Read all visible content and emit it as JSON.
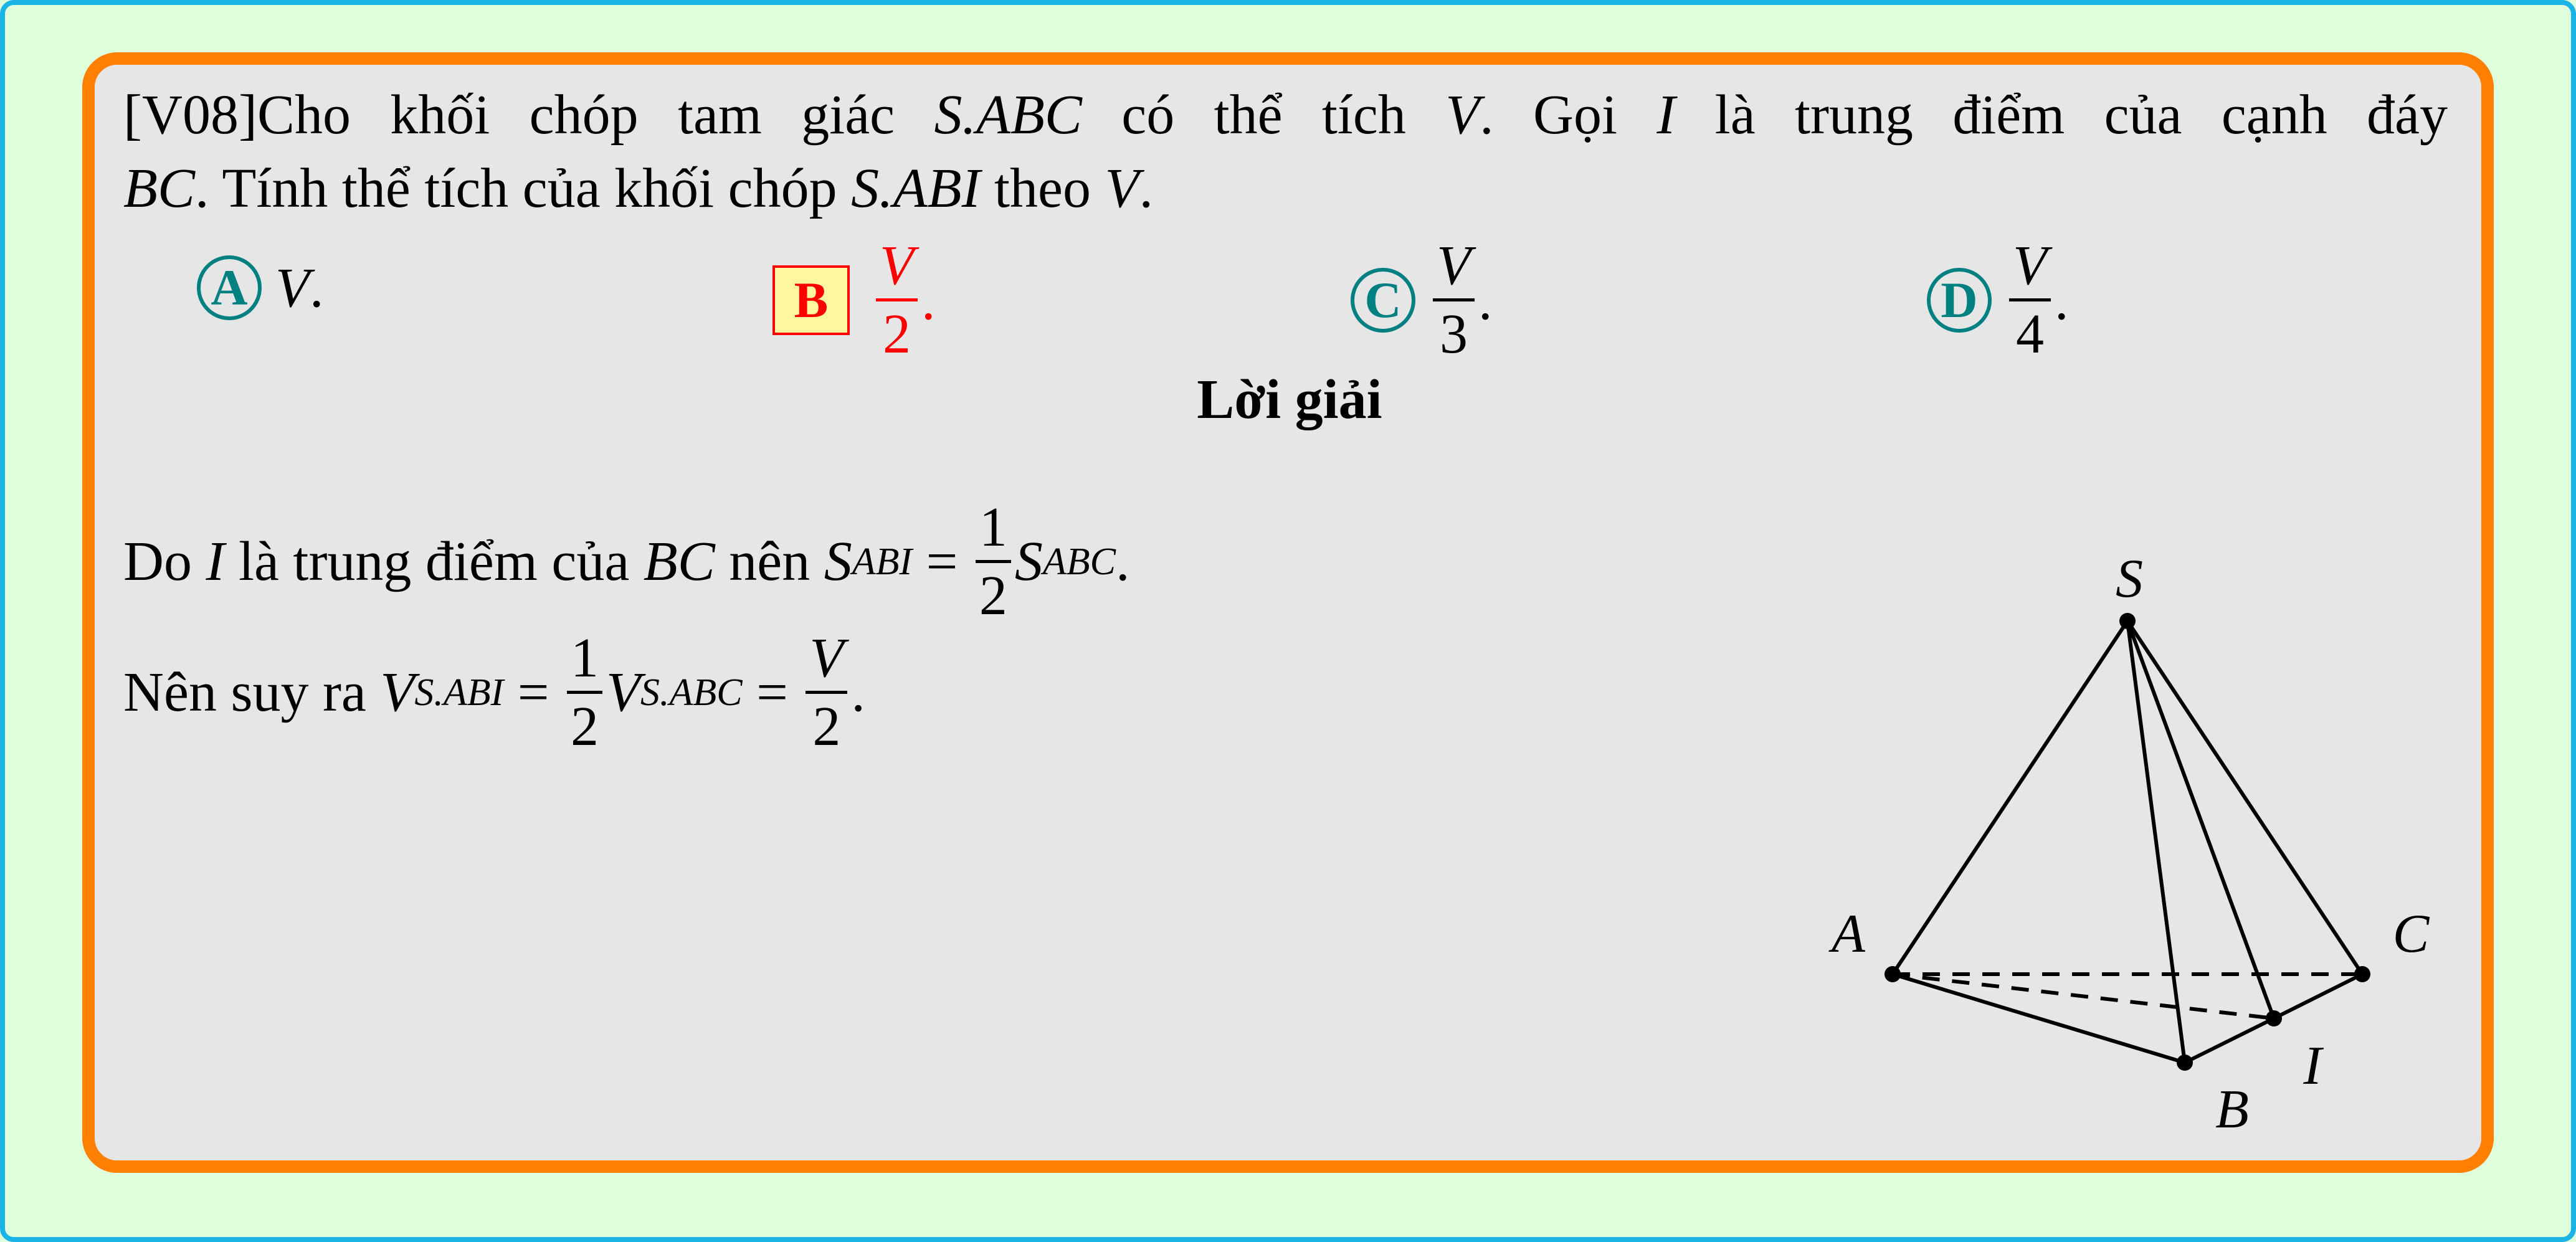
{
  "question": {
    "tag": "[V08]",
    "line1": [
      "Cho khối chóp tam giác ",
      "S.ABC",
      " có thể tích ",
      "V",
      ". Gọi ",
      "I",
      " là trung điểm của cạnh đáy"
    ],
    "line2": [
      "BC",
      ". Tính thể tích của khối chóp ",
      "S.ABI",
      " theo ",
      "V",
      "."
    ]
  },
  "options": [
    {
      "letter": "A",
      "value": "V",
      "suffix": ".",
      "correct": false
    },
    {
      "letter": "B",
      "num": "V",
      "den": "2",
      "suffix": ".",
      "correct": true
    },
    {
      "letter": "C",
      "num": "V",
      "den": "3",
      "suffix": ".",
      "correct": false
    },
    {
      "letter": "D",
      "num": "V",
      "den": "4",
      "suffix": ".",
      "correct": false
    }
  ],
  "solution": {
    "title": "Lời giải",
    "line1": {
      "t1": "Do ",
      "I": "I",
      "t2": " là trung điểm của ",
      "BC": "BC",
      "t3": " nên ",
      "S": "S",
      "sub1": "ABI",
      "eq": " = ",
      "num": "1",
      "den": "2",
      "S2": "S",
      "sub2": "ABC",
      "end": "."
    },
    "line2": {
      "t1": "Nên suy ra ",
      "V": "V",
      "sub1": "S.ABI",
      "eq1": " = ",
      "num": "1",
      "den": "2",
      "V2": "V",
      "sub2": "S.ABC",
      "eq2": " = ",
      "fnum": "V",
      "fden": "2",
      "end": "."
    }
  },
  "figure": {
    "labels": {
      "S": "S",
      "A": "A",
      "B": "B",
      "C": "C",
      "I": "I"
    },
    "solid_edges": [
      [
        "S",
        "A"
      ],
      [
        "S",
        "B"
      ],
      [
        "S",
        "I"
      ],
      [
        "S",
        "C"
      ],
      [
        "A",
        "B"
      ],
      [
        "B",
        "I"
      ],
      [
        "I",
        "C"
      ]
    ],
    "dashed_edges": [
      [
        "A",
        "C"
      ],
      [
        "A",
        "I"
      ]
    ]
  },
  "colors": {
    "correct": "#ff0000",
    "option": "#008080",
    "frame": "#ff7f00",
    "outer_border": "#19b3e6",
    "highlight": "#fff7a0"
  }
}
